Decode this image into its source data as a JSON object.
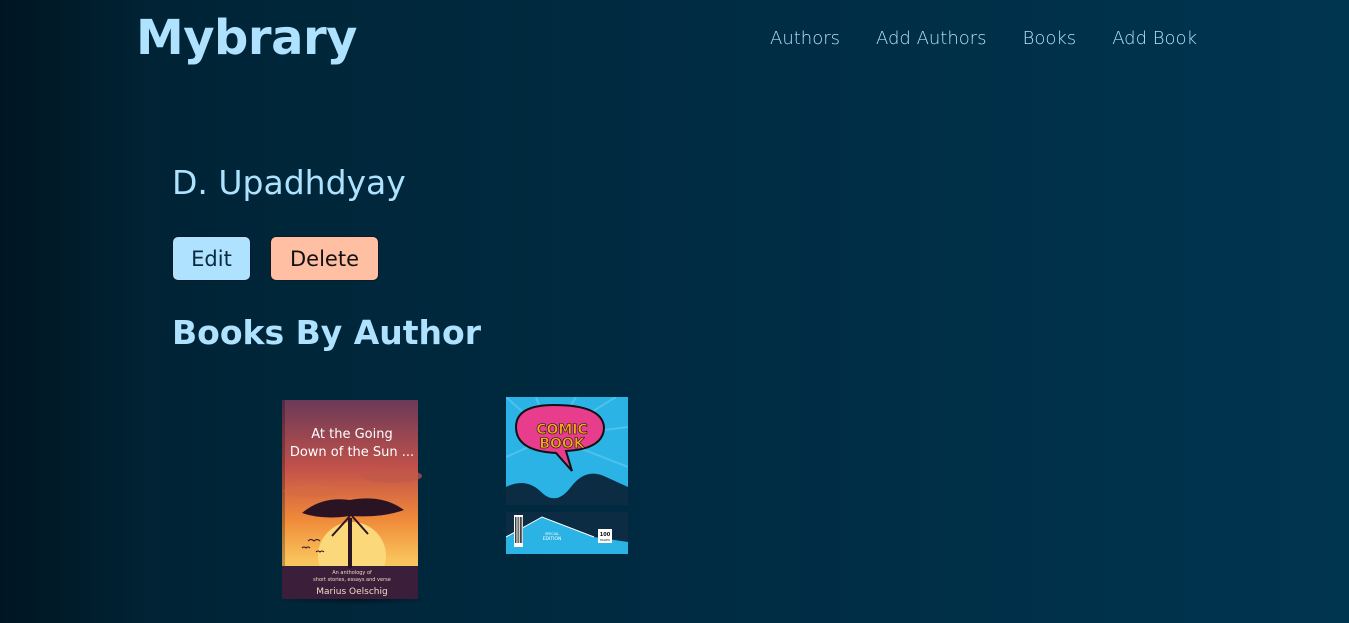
{
  "header": {
    "logo": "Mybrary",
    "nav": [
      "Authors",
      "Add Authors",
      "Books",
      "Add Book"
    ]
  },
  "author": {
    "name": "D. Upadhdyay"
  },
  "actions": {
    "edit_label": "Edit",
    "delete_label": "Delete"
  },
  "books_section": {
    "title": "Books By Author",
    "books": [
      {
        "cover_title_line1": "At the Going",
        "cover_title_line2": "Down of the Sun ...",
        "cover_subtitle_line1": "An anthology of",
        "cover_subtitle_line2": "short stories, essays and verse",
        "cover_author": "Marius Oelschig"
      },
      {
        "cover_title_line1": "COMIC",
        "cover_title_line2": "BOOK",
        "cover_edition_line1": "SPECIAL",
        "cover_edition_line2": "EDITION",
        "cover_pages_line1": "100",
        "cover_pages_line2": "PAGES"
      }
    ]
  },
  "colors": {
    "text_primary": "#aee2ff",
    "edit_button": "#aee2ff",
    "delete_button": "#ffbfa3",
    "background_start": "#001522",
    "background_end": "#003550"
  }
}
